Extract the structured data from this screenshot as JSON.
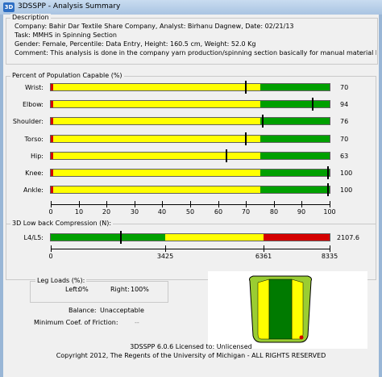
{
  "window": {
    "title": "3DSSPP - Analysis Summary",
    "icon_text": "3D"
  },
  "description": {
    "group_label": "Description",
    "lines": [
      "Company: Bahir Dar Textile Share Company, Analyst: Birhanu Dagnew, Date: 02/21/13",
      "Task: MMHS in Spinning Section",
      "Gender: Female, Percentile: Data Entry, Height: 160.5 cm, Weight: 52.0 Kg",
      "Comment: This analysis is done in the company yarn production/spinning section basically for manual material handling worl"
    ]
  },
  "population": {
    "group_label": "Percent of Population Capable (%)",
    "rows": [
      {
        "label": "Wrist:",
        "value": "70",
        "level": 70
      },
      {
        "label": "Elbow:",
        "value": "94",
        "level": 94
      },
      {
        "label": "Shoulder:",
        "value": "76",
        "level": 76
      },
      {
        "label": "Torso:",
        "value": "70",
        "level": 70
      },
      {
        "label": "Hip:",
        "value": "63",
        "level": 63
      },
      {
        "label": "Knee:",
        "value": "100",
        "level": 100
      },
      {
        "label": "Ankle:",
        "value": "100",
        "level": 100
      }
    ],
    "zones": {
      "red_end": 1,
      "green_start": 75,
      "max": 100
    },
    "ticks": [
      "0",
      "10",
      "20",
      "30",
      "40",
      "50",
      "60",
      "70",
      "80",
      "90",
      "100"
    ],
    "colors": {
      "red": "#d40000",
      "yellow": "#ffff00",
      "green": "#00a000"
    }
  },
  "compression": {
    "group_label": "3D Low back Compression (N):",
    "label": "L4/L5:",
    "value": "2107.6",
    "level": 2107.6,
    "max": 8335,
    "zones": [
      {
        "to": 3425,
        "color": "#00a000"
      },
      {
        "to": 6361,
        "color": "#ffff00"
      },
      {
        "to": 8335,
        "color": "#d40000"
      }
    ],
    "ticks": [
      {
        "label": "0",
        "value": 0
      },
      {
        "label": "3425",
        "value": 3425
      },
      {
        "label": "6361",
        "value": 6361
      },
      {
        "label": "8335",
        "value": 8335
      }
    ]
  },
  "leg_loads": {
    "group_label": "Leg Loads (%):",
    "left_label": "Left:",
    "left_value": "0%",
    "right_label": "Right:",
    "right_value": "100%"
  },
  "balance": {
    "label": "Balance:",
    "value": "Unacceptable"
  },
  "friction": {
    "label": "Minimum Coef. of Friction:",
    "value": "--"
  },
  "footer": {
    "license": "3DSSPP 6.0.6 Licensed to: Unlicensed",
    "copyright": "Copyright 2012, The Regents of the University of Michigan - ALL RIGHTS RESERVED"
  }
}
